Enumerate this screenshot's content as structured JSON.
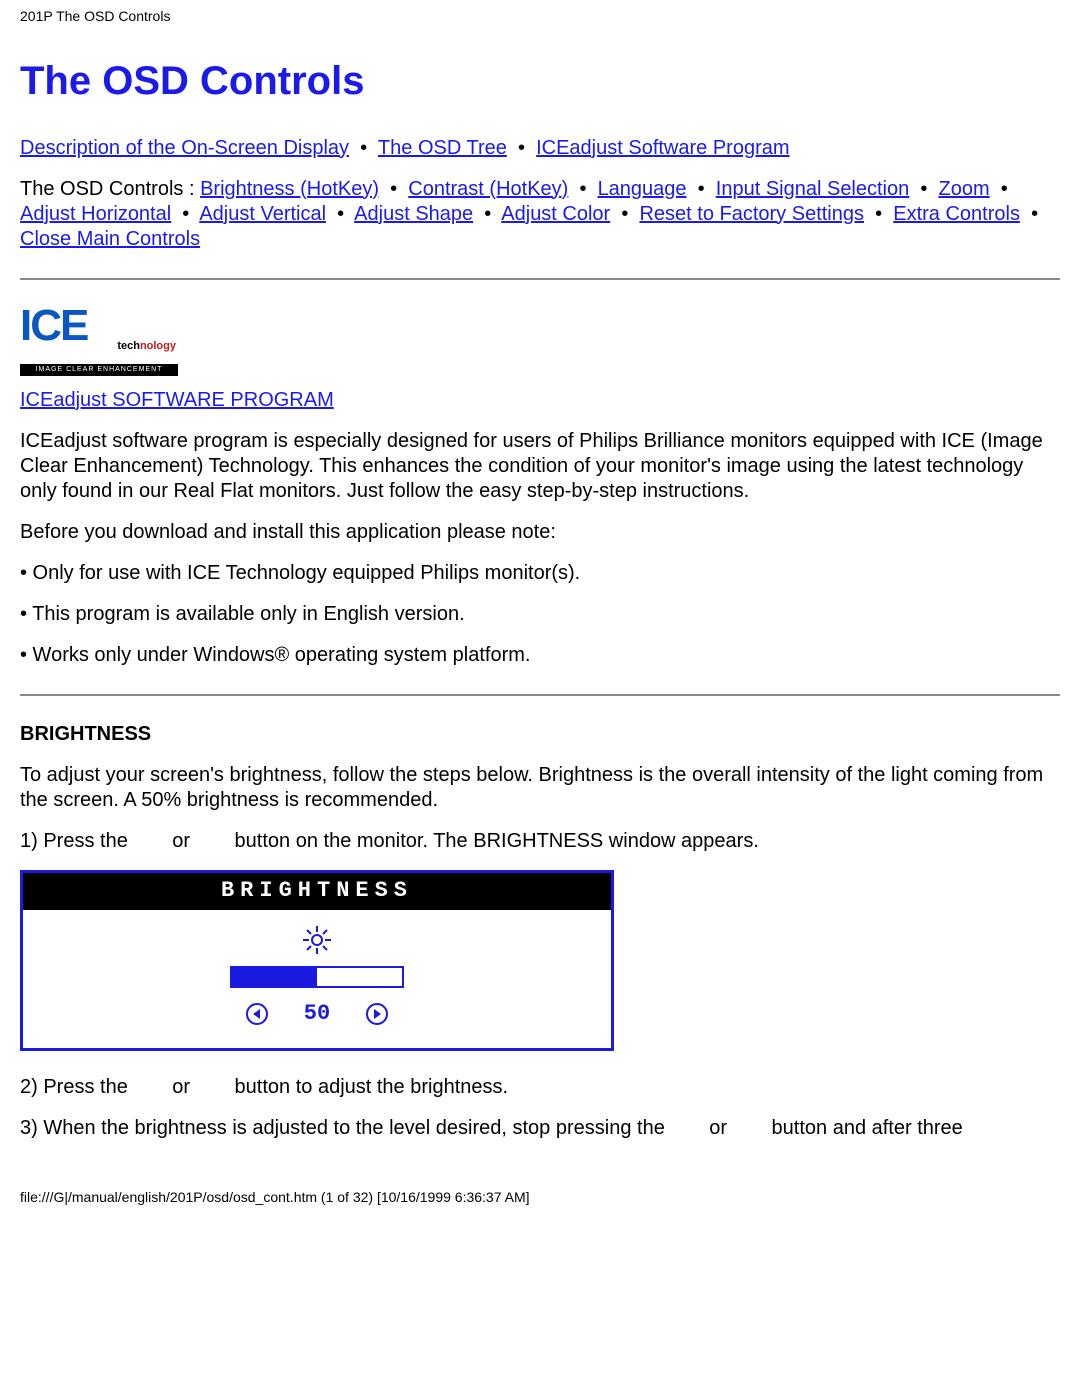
{
  "header_small": "201P The OSD Controls",
  "title": "The OSD Controls",
  "nav_top": {
    "l1": "Description of the On-Screen Display",
    "l2": "The OSD Tree",
    "l3": "ICEadjust Software Program"
  },
  "nav_bot": {
    "prefix": "The OSD Controls : ",
    "l1": "Brightness (HotKey)",
    "l2": "Contrast (HotKey)",
    "l3": "Language",
    "l4": "Input Signal Selection",
    "l5": "Zoom",
    "l6": "Adjust Horizontal",
    "l7": "Adjust Vertical",
    "l8": "Adjust Shape",
    "l9": "Adjust Color",
    "l10": "Reset to Factory Settings",
    "l11": "Extra Controls",
    "l12": "Close Main Controls"
  },
  "ice": {
    "logo_big": "ICE",
    "logo_tech_black": "tech",
    "logo_tech_red": "nology",
    "logo_bar": "IMAGE CLEAR ENHANCEMENT",
    "program_link": "ICEadjust SOFTWARE PROGRAM",
    "para": "ICEadjust software program is especially designed for users of Philips Brilliance monitors equipped with ICE (Image Clear Enhancement) Technology. This enhances the condition of your monitor's image using the latest technology only found in our Real Flat monitors. Just follow the easy step-by-step instructions.",
    "before": "Before you download and install this application please note:",
    "b1": "• Only for use with ICE Technology equipped Philips monitor(s).",
    "b2": "• This program is available only in English version.",
    "b3": "• Works only under Windows® operating system platform."
  },
  "brightness": {
    "head": "BRIGHTNESS",
    "intro": "To adjust your screen's brightness, follow the steps below. Brightness is the overall intensity of the light coming from the screen. A 50% brightness is recommended.",
    "s1a": "1) Press the ",
    "s1_or": "or",
    "s1b": "button on the monitor. The BRIGHTNESS window appears.",
    "osd_title": "BRIGHTNESS",
    "osd_value": "50",
    "osd_fill_pct": 50,
    "s2a": "2) Press the ",
    "s2_or": "or",
    "s2b": "button to adjust the brightness.",
    "s3a": "3) When the brightness is adjusted to the level desired, stop pressing the ",
    "s3_or": "or",
    "s3b": "button and after three"
  },
  "footer": "file:///G|/manual/english/201P/osd/osd_cont.htm (1 of 32) [10/16/1999 6:36:37 AM]"
}
